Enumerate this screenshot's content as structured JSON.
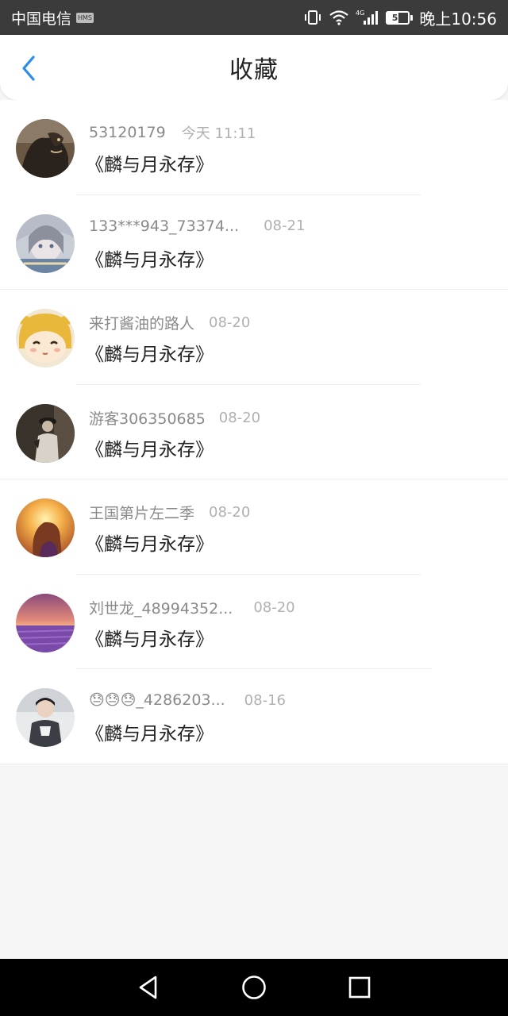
{
  "status_bar": {
    "carrier": "中国电信",
    "hms_badge": "HMS",
    "battery": "52",
    "battery_level": 0.52,
    "time": "晚上10:56"
  },
  "header": {
    "title": "收藏",
    "accent_color": "#2a8ee8"
  },
  "favorites": [
    {
      "user": "53120179",
      "date": "今天 11:11",
      "title": "《麟与月永存》",
      "avatar": "monster-avatar"
    },
    {
      "user": "133***943_73374...",
      "date": "08-21",
      "title": "《麟与月永存》",
      "avatar": "anime-girl-avatar"
    },
    {
      "user": "来打酱油的路人",
      "date": "08-20",
      "title": "《麟与月永存》",
      "avatar": "cartoon-face-avatar"
    },
    {
      "user": "游客306350685",
      "date": "08-20",
      "title": "《麟与月永存》",
      "avatar": "dark-photo-avatar"
    },
    {
      "user": "王国第片左二季",
      "date": "08-20",
      "title": "《麟与月永存》",
      "avatar": "sunset-girl-avatar"
    },
    {
      "user": "刘世龙_48994352...",
      "date": "08-20",
      "title": "《麟与月永存》",
      "avatar": "lavender-field-avatar"
    },
    {
      "user": "😓😓😓_4286203...",
      "date": "08-16",
      "title": "《麟与月永存》",
      "avatar": "boy-photo-avatar"
    }
  ],
  "nav": {
    "back": "back-triangle-icon",
    "home": "home-circle-icon",
    "recent": "recent-square-icon"
  }
}
